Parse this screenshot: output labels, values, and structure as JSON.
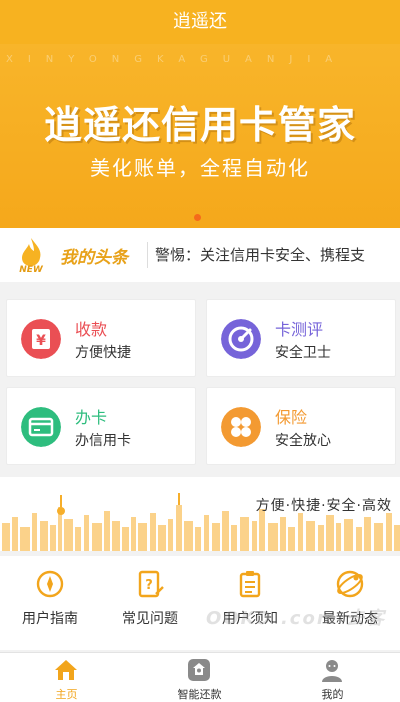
{
  "header": {
    "title": "逍遥还"
  },
  "banner": {
    "letters": "XINYONGKAGUANJIA",
    "title": "逍遥还信用卡管家",
    "subtitle": "美化账单，全程自动化",
    "active_slide": 1
  },
  "news": {
    "logo_text": "NEW",
    "title": "我的头条",
    "text": "警惕：关注信用卡安全、携程支"
  },
  "cards": [
    {
      "title": "收款",
      "subtitle": "方便快捷",
      "icon": "yen-icon",
      "color": "#ea4f54"
    },
    {
      "title": "卡测评",
      "subtitle": "安全卫士",
      "icon": "gauge-icon",
      "color": "#7664d9"
    },
    {
      "title": "办卡",
      "subtitle": "办信用卡",
      "icon": "card-icon",
      "color": "#2ebd7e"
    },
    {
      "title": "保险",
      "subtitle": "安全放心",
      "icon": "clover-icon",
      "color": "#f39a32"
    }
  ],
  "skyline": {
    "slogan": "方便·快捷·安全·高效"
  },
  "guides": [
    {
      "label": "用户指南",
      "icon": "compass-icon"
    },
    {
      "label": "常见问题",
      "icon": "question-doc-icon"
    },
    {
      "label": "用户须知",
      "icon": "clipboard-icon"
    },
    {
      "label": "最新动态",
      "icon": "satellite-icon"
    }
  ],
  "watermark": "OOKO .com 去客",
  "tabs": [
    {
      "label": "主页",
      "icon": "home-icon",
      "active": true
    },
    {
      "label": "智能还款",
      "icon": "smart-repay-icon",
      "active": false
    },
    {
      "label": "我的",
      "icon": "user-icon",
      "active": false
    }
  ],
  "colors": {
    "primary": "#f7b220",
    "accent": "#f2a51c"
  }
}
